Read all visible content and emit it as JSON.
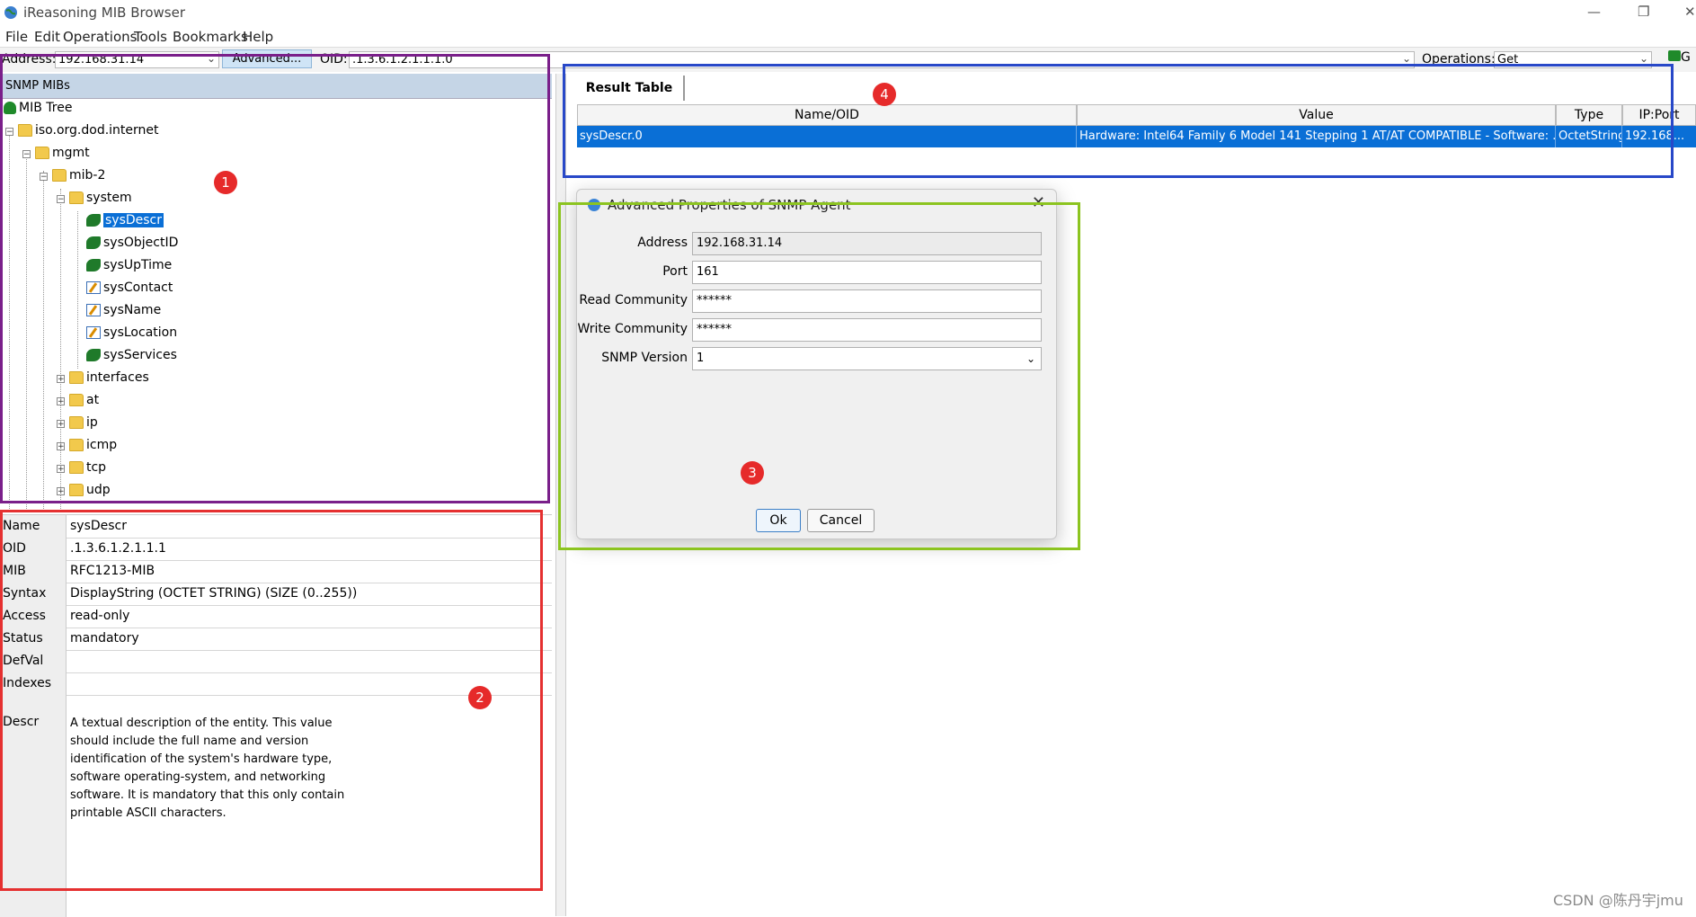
{
  "window": {
    "title": "iReasoning MIB Browser",
    "controls": {
      "minimize": "—",
      "restore": "❐",
      "close": "✕"
    }
  },
  "menubar": [
    "File",
    "Edit",
    "Operations",
    "Tools",
    "Bookmarks",
    "Help"
  ],
  "toolbar": {
    "address_label": "Address:",
    "address_value": "192.168.31.14",
    "advanced_label": "Advanced...",
    "oid_label": "OID:",
    "oid_value": ".1.3.6.1.2.1.1.1.0",
    "operations_label": "Operations:",
    "operations_value": "Get",
    "go_label": "G"
  },
  "left_panel": {
    "header": "SNMP MIBs",
    "tree": {
      "root": "MIB Tree",
      "iso": "iso.org.dod.internet",
      "mgmt": "mgmt",
      "mib2": "mib-2",
      "system": "system",
      "leaves": [
        "sysDescr",
        "sysObjectID",
        "sysUpTime",
        "sysContact",
        "sysName",
        "sysLocation",
        "sysServices"
      ],
      "folders": [
        "interfaces",
        "at",
        "ip",
        "icmp",
        "tcp",
        "udp"
      ]
    }
  },
  "properties": {
    "rows": [
      {
        "key": "Name",
        "value": "sysDescr"
      },
      {
        "key": "OID",
        "value": ".1.3.6.1.2.1.1.1"
      },
      {
        "key": "MIB",
        "value": "RFC1213-MIB"
      },
      {
        "key": "Syntax",
        "value": "DisplayString (OCTET STRING) (SIZE (0..255))"
      },
      {
        "key": "Access",
        "value": "read-only"
      },
      {
        "key": "Status",
        "value": "mandatory"
      },
      {
        "key": "DefVal",
        "value": ""
      },
      {
        "key": "Indexes",
        "value": ""
      }
    ],
    "descr_key": "Descr",
    "descr_value": " A textual description of the entity.  This value\nshould include the full name and version\nidentification of the system's hardware type,\nsoftware operating-system, and networking\nsoftware.  It is mandatory that this only contain\nprintable ASCII characters."
  },
  "result_table": {
    "tab": "Result Table",
    "columns": [
      "Name/OID",
      "Value",
      "Type",
      "IP:Port"
    ],
    "row": {
      "name": "sysDescr.0",
      "value": "Hardware: Intel64 Family 6 Model 141 Stepping 1 AT/AT COMPATIBLE - Software: ...",
      "type": "OctetString",
      "ip": "192.168..."
    }
  },
  "dialog": {
    "title": "Advanced Properties of SNMP Agent",
    "close": "✕",
    "fields": [
      {
        "label": "Address",
        "value": "192.168.31.14"
      },
      {
        "label": "Port",
        "value": "161"
      },
      {
        "label": "Read Community",
        "value": "******"
      },
      {
        "label": "Write Community",
        "value": "******"
      },
      {
        "label": "SNMP Version",
        "value": "1"
      }
    ],
    "ok": "Ok",
    "cancel": "Cancel"
  },
  "annotations": {
    "badges": [
      "1",
      "2",
      "3",
      "4"
    ],
    "colors": {
      "box1": "#7a1f8a",
      "box2": "#e53030",
      "box3": "#8cc420",
      "box4": "#2848c8",
      "badge": "#e62a2a"
    }
  },
  "watermark": "CSDN @陈丹宇jmu"
}
